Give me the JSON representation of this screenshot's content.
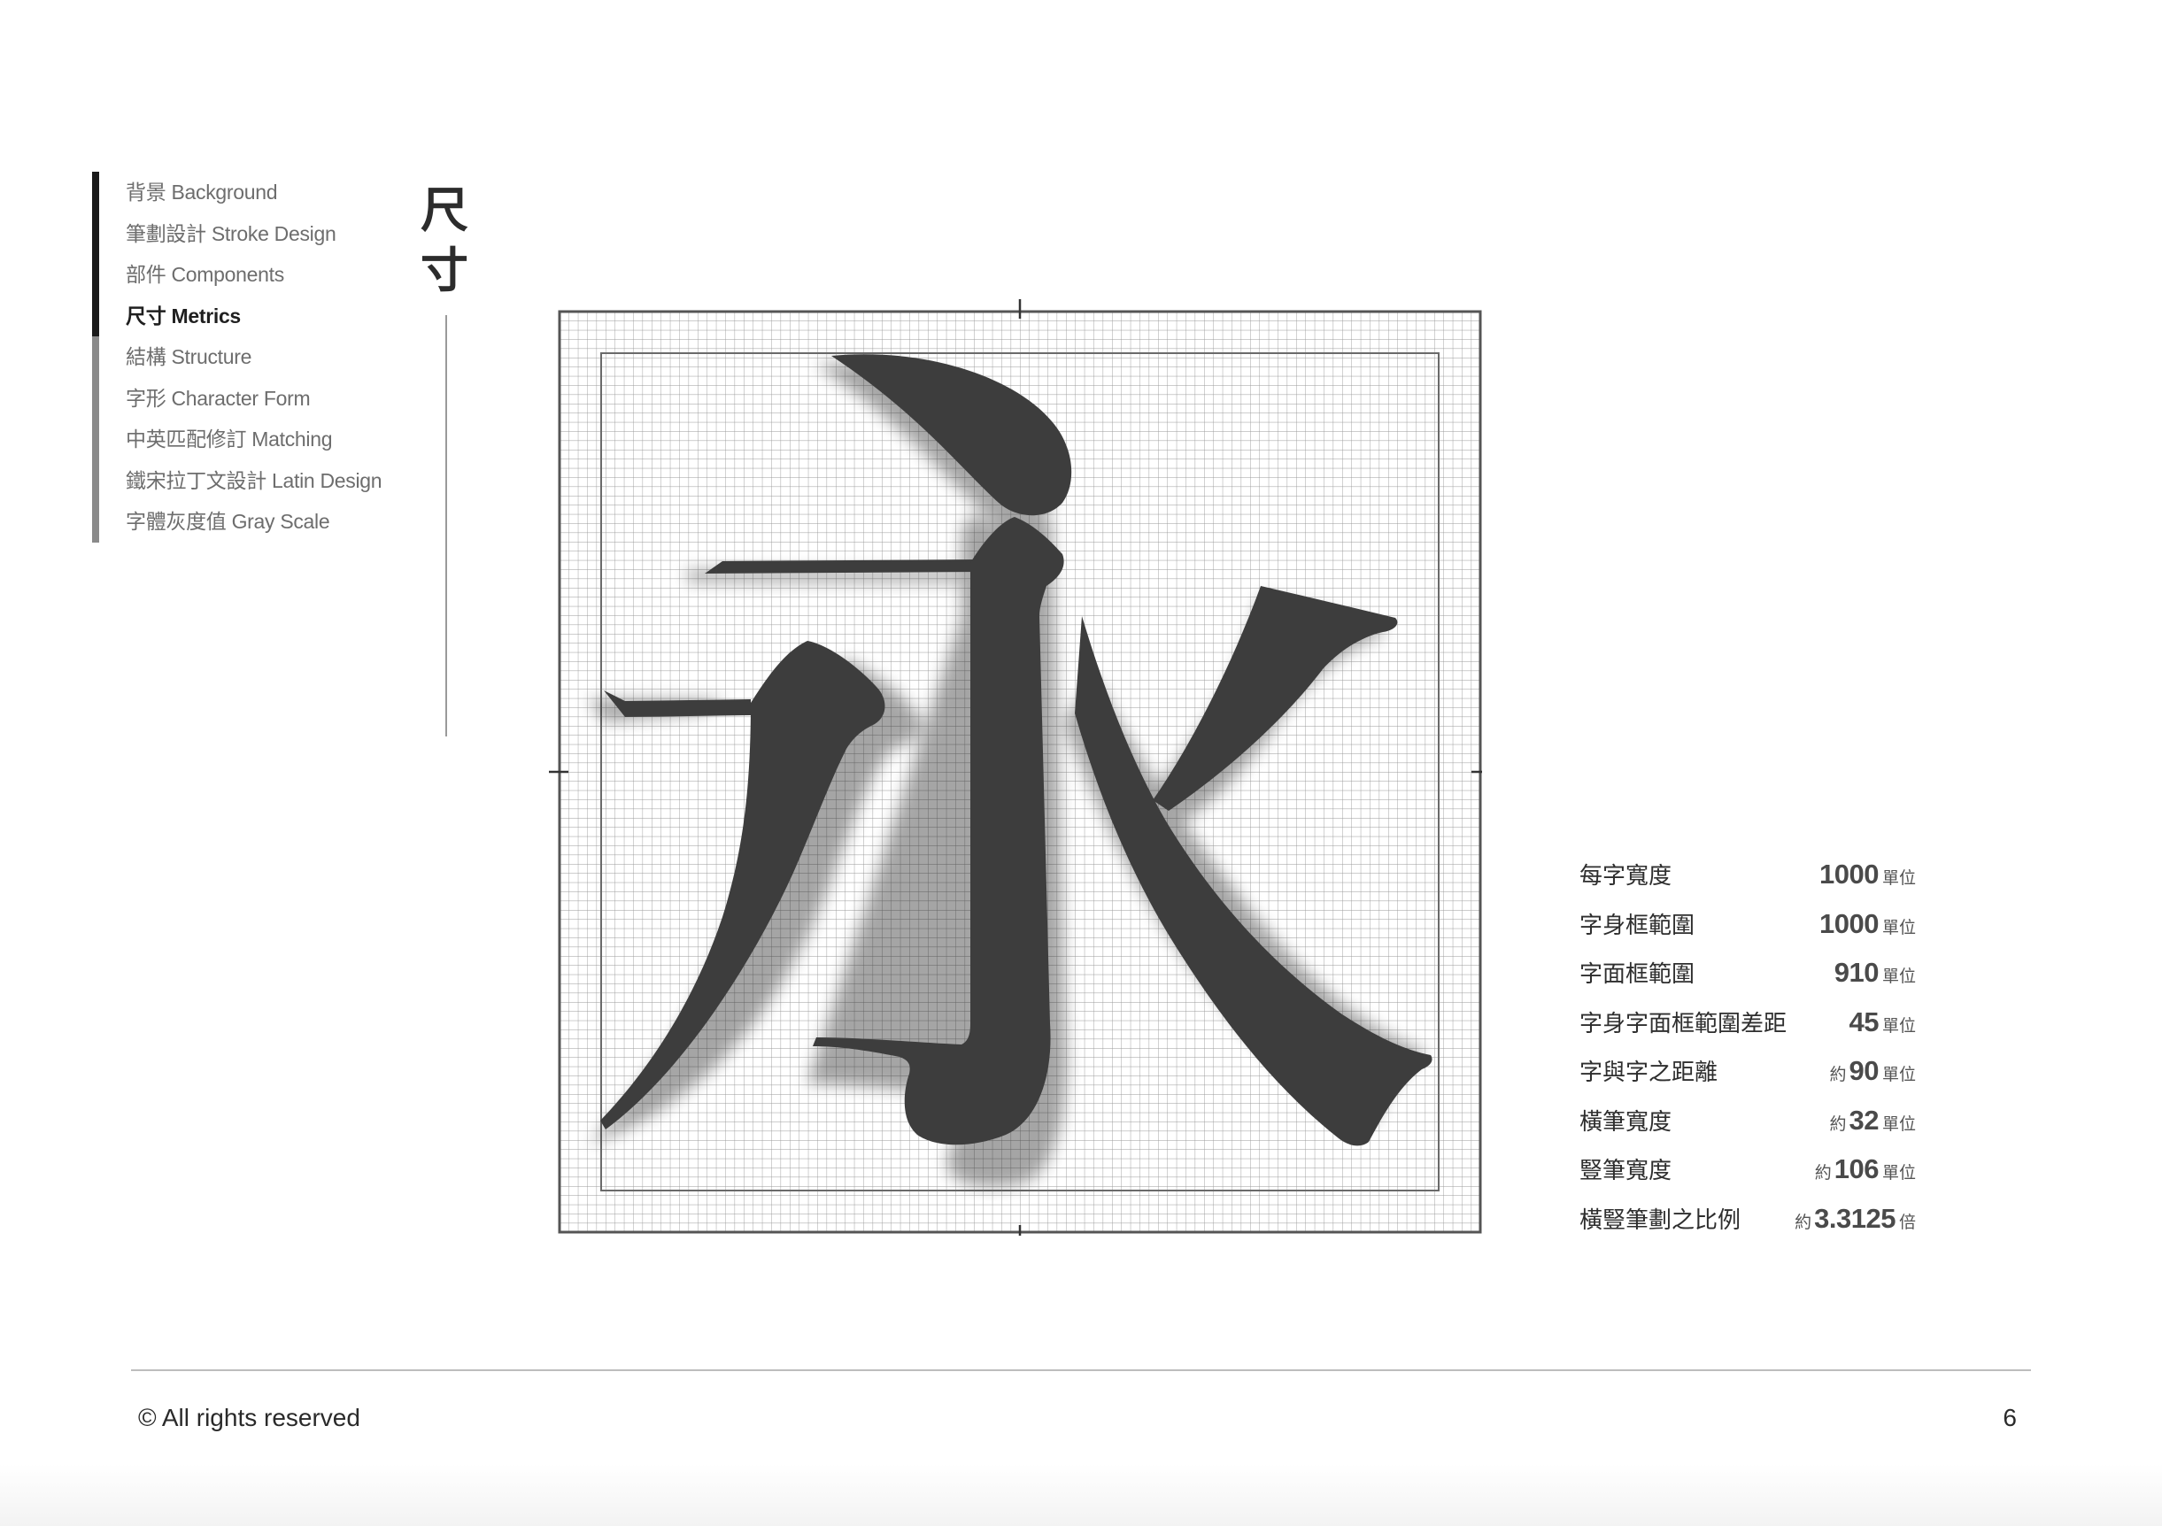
{
  "nav": {
    "items": [
      {
        "label": "背景 Background",
        "active": false
      },
      {
        "label": "筆劃設計 Stroke Design",
        "active": false
      },
      {
        "label": "部件 Components",
        "active": false
      },
      {
        "label": "尺寸 Metrics",
        "active": true
      },
      {
        "label": "結構 Structure",
        "active": false
      },
      {
        "label": "字形 Character Form",
        "active": false
      },
      {
        "label": "中英匹配修訂 Matching",
        "active": false
      },
      {
        "label": "鐵宋拉丁文設計 Latin Design",
        "active": false
      },
      {
        "label": "字體灰度值 Gray Scale",
        "active": false
      }
    ]
  },
  "section": {
    "title_chars": [
      "尺",
      "寸"
    ]
  },
  "glyph": {
    "sample_character": "永",
    "glyph_color": "#3d3d3d"
  },
  "metrics": [
    {
      "label": "每字寬度",
      "prefix": "",
      "value": "1000",
      "unit": "單位"
    },
    {
      "label": "字身框範圍",
      "prefix": "",
      "value": "1000",
      "unit": "單位"
    },
    {
      "label": "字面框範圍",
      "prefix": "",
      "value": "910",
      "unit": "單位"
    },
    {
      "label": "字身字面框範圍差距",
      "prefix": "",
      "value": "45",
      "unit": "單位"
    },
    {
      "label": "字與字之距離",
      "prefix": "約",
      "value": "90",
      "unit": "單位"
    },
    {
      "label": "橫筆寬度",
      "prefix": "約",
      "value": "32",
      "unit": "單位"
    },
    {
      "label": "豎筆寬度",
      "prefix": "約",
      "value": "106",
      "unit": "單位"
    },
    {
      "label": "橫豎筆劃之比例",
      "prefix": "約",
      "value": "3.3125",
      "unit": "倍"
    }
  ],
  "footer": {
    "copyright": "© All rights reserved",
    "page_number": "6"
  }
}
